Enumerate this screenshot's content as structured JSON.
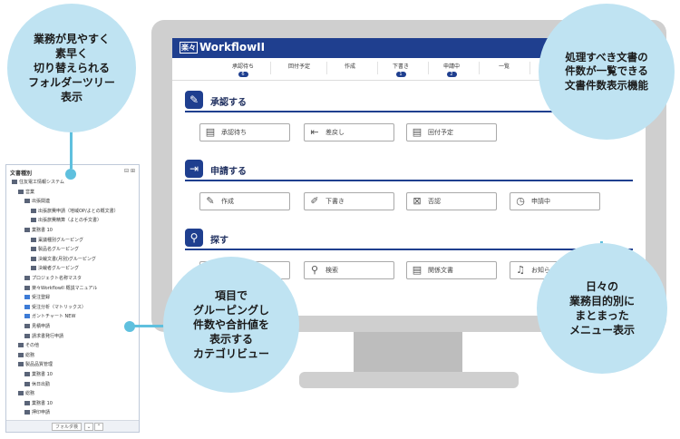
{
  "app": {
    "logo_mark": "楽々",
    "logo_name": "WorkflowII"
  },
  "nav": [
    {
      "label": "承認待ち",
      "badge": "6"
    },
    {
      "label": "回付予定",
      "badge": ""
    },
    {
      "label": "作成",
      "badge": ""
    },
    {
      "label": "下書き",
      "badge": "1"
    },
    {
      "label": "申請中",
      "badge": "2"
    },
    {
      "label": "一覧",
      "badge": ""
    }
  ],
  "sections": {
    "approve": {
      "title": "承認する",
      "buttons": [
        "承認待ち",
        "差戻し",
        "回付予定"
      ]
    },
    "apply": {
      "title": "申請する",
      "buttons": [
        "作成",
        "下書き",
        "否認",
        "申請中"
      ]
    },
    "search": {
      "title": "探す",
      "buttons": [
        "",
        "検索",
        "関係文書",
        "お知らせ"
      ]
    }
  },
  "tree": {
    "title": "文書種別",
    "controls": "⊟ ⊞",
    "rows": [
      {
        "label": "住友電工情報システム",
        "indent": 0,
        "blue": false
      },
      {
        "label": "営業",
        "indent": 1,
        "blue": false
      },
      {
        "label": "出張関連",
        "indent": 2,
        "blue": false
      },
      {
        "label": "出張旅費申請（地域OP/よとの概文書）",
        "indent": 3,
        "blue": false
      },
      {
        "label": "出張旅費精算（よとの手文書）",
        "indent": 3,
        "blue": false
      },
      {
        "label": "業務書 10",
        "indent": 2,
        "blue": false
      },
      {
        "label": "稟議種別グルーピング",
        "indent": 3,
        "blue": false
      },
      {
        "label": "製品名グルーピング",
        "indent": 3,
        "blue": false
      },
      {
        "label": "決裁文書(月別)グルーピング",
        "indent": 3,
        "blue": false
      },
      {
        "label": "決裁者グルーピング",
        "indent": 3,
        "blue": false
      },
      {
        "label": "プロジェクト名称マスタ",
        "indent": 2,
        "blue": false
      },
      {
        "label": "楽々WorkflowII 概説マニュアル",
        "indent": 2,
        "blue": false
      },
      {
        "label": "受注登録",
        "indent": 2,
        "blue": true
      },
      {
        "label": "受注分析（マトリックス）",
        "indent": 2,
        "blue": true
      },
      {
        "label": "ガントチャート NEW",
        "indent": 2,
        "blue": true
      },
      {
        "label": "見積申請",
        "indent": 2,
        "blue": false
      },
      {
        "label": "請求書発行申請",
        "indent": 2,
        "blue": false
      },
      {
        "label": "その他",
        "indent": 1,
        "blue": false
      },
      {
        "label": "総務",
        "indent": 1,
        "blue": false
      },
      {
        "label": "製品品質管理",
        "indent": 1,
        "blue": false
      },
      {
        "label": "業務書 10",
        "indent": 2,
        "blue": false
      },
      {
        "label": "休日出勤",
        "indent": 2,
        "blue": false
      },
      {
        "label": "総務",
        "indent": 1,
        "blue": false
      },
      {
        "label": "業務書 10",
        "indent": 2,
        "blue": false
      },
      {
        "label": "押印申請",
        "indent": 2,
        "blue": false
      }
    ],
    "footer_label": "フォルダ検"
  },
  "bubbles": {
    "folder_tree": "業務が見やすく\n素早く\n切り替えられる\nフォルダーツリー\n表示",
    "doc_count": "処理すべき文書の\n件数が一覧できる\n文書件数表示機能",
    "category_view": "項目で\nグルーピングし\n件数や合計値を\n表示する\nカテゴリビュー",
    "menu_view": "日々の\n業務目的別に\nまとまった\nメニュー表示"
  },
  "colors": {
    "accent": "#1f3f8f",
    "bubble": "#bfe3f2",
    "connector": "#5fc0de"
  }
}
